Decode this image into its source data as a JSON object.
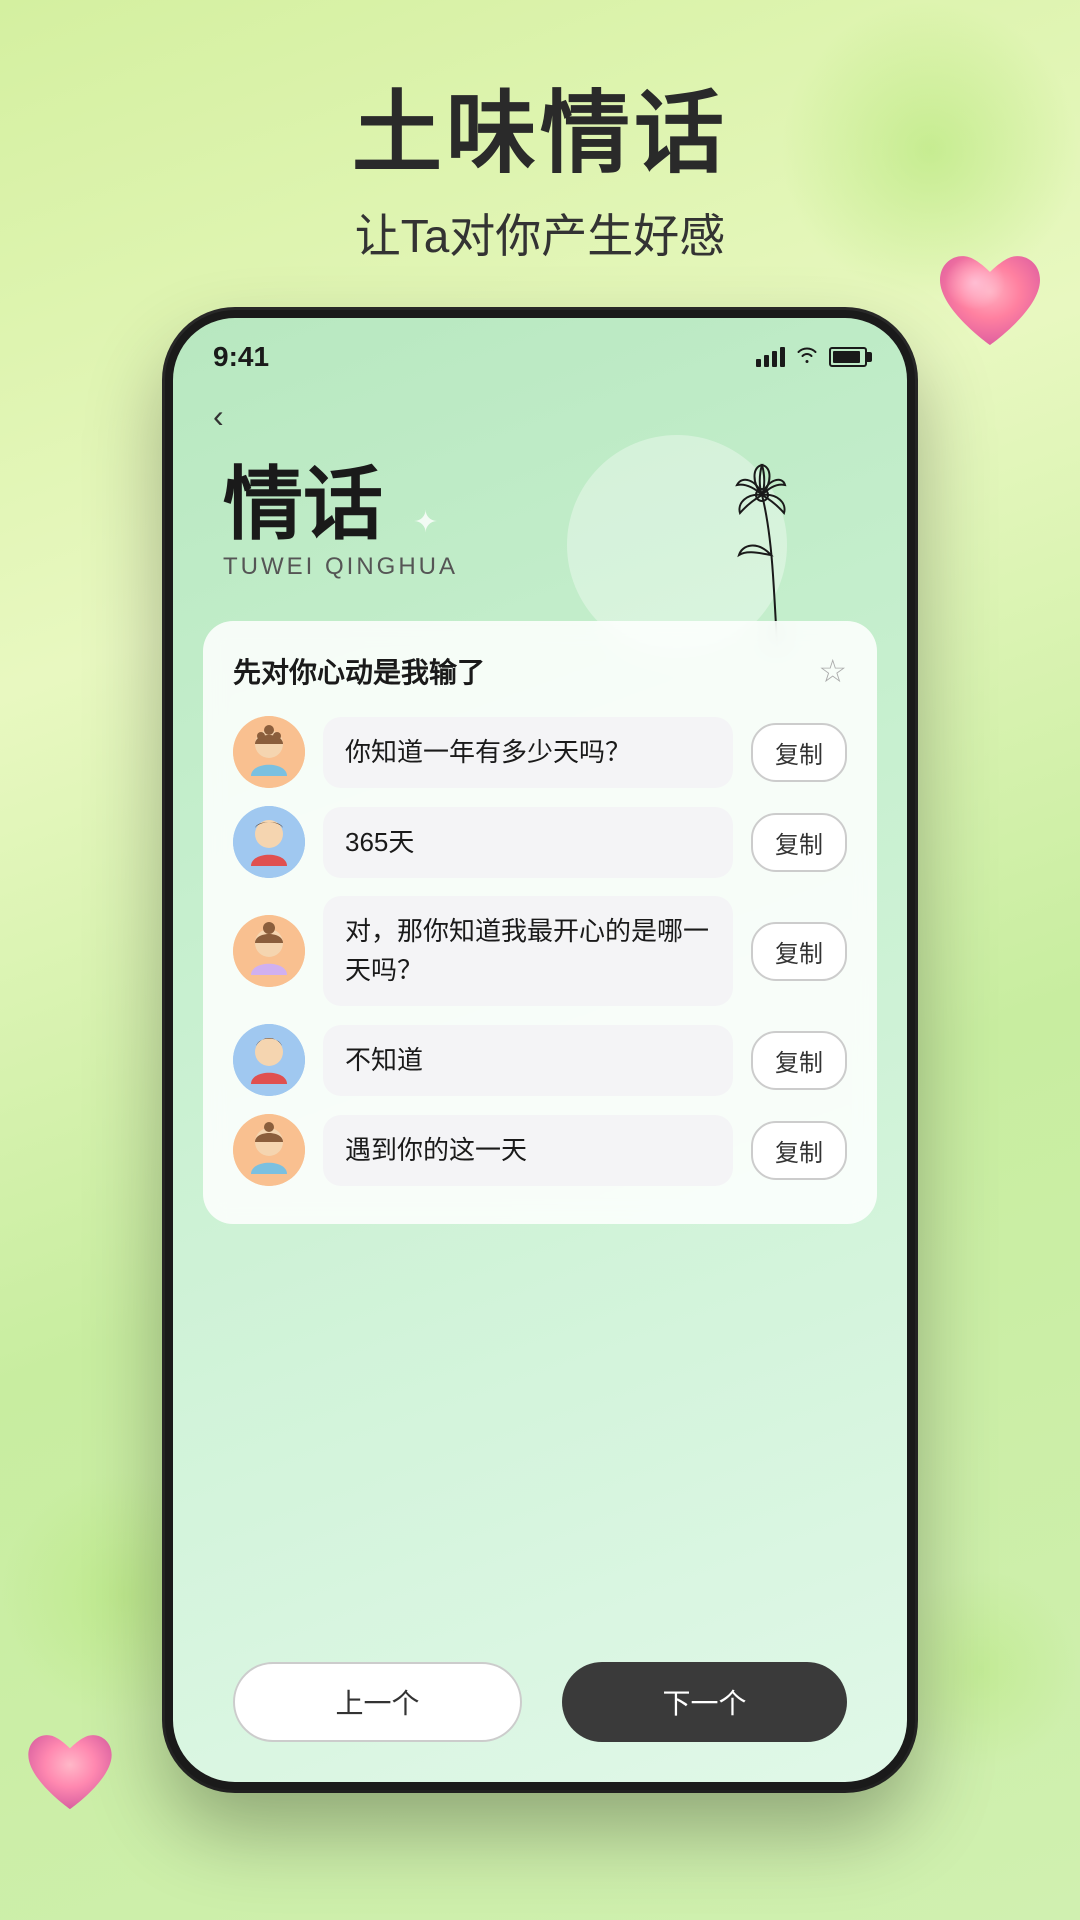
{
  "page": {
    "bg_title_main": "土味情话",
    "bg_title_sub": "让Ta对你产生好感"
  },
  "status_bar": {
    "time": "9:41"
  },
  "app": {
    "title_cn": "情话",
    "title_pinyin": "TUWEI QINGHUA",
    "back_label": "‹"
  },
  "card": {
    "title": "先对你心动是我输了",
    "star_label": "☆",
    "conversations": [
      {
        "id": 1,
        "avatar_type": "girl",
        "text": "你知道一年有多少天吗？",
        "copy_label": "复制"
      },
      {
        "id": 2,
        "avatar_type": "boy",
        "text": "365天",
        "copy_label": "复制"
      },
      {
        "id": 3,
        "avatar_type": "girl",
        "text": "对，那你知道我最开心的是哪一天吗？",
        "copy_label": "复制"
      },
      {
        "id": 4,
        "avatar_type": "boy",
        "text": "不知道",
        "copy_label": "复制"
      },
      {
        "id": 5,
        "avatar_type": "girl",
        "text": "遇到你的这一天",
        "copy_label": "复制"
      }
    ]
  },
  "bottom_nav": {
    "prev_label": "上一个",
    "next_label": "下一个"
  }
}
